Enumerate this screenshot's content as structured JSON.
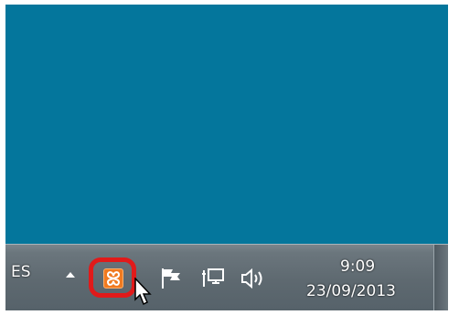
{
  "taskbar": {
    "language": "ES",
    "clock": {
      "time": "9:09",
      "date": "23/09/2013"
    }
  },
  "tray": {
    "icons": [
      "show-hidden-icons-arrow",
      "xampp-icon",
      "action-center-flag-icon",
      "network-icon",
      "volume-icon"
    ],
    "highlight_color": "#e11a1a"
  },
  "colors": {
    "desktop": "#04769c",
    "taskbar": "#5e6970"
  }
}
